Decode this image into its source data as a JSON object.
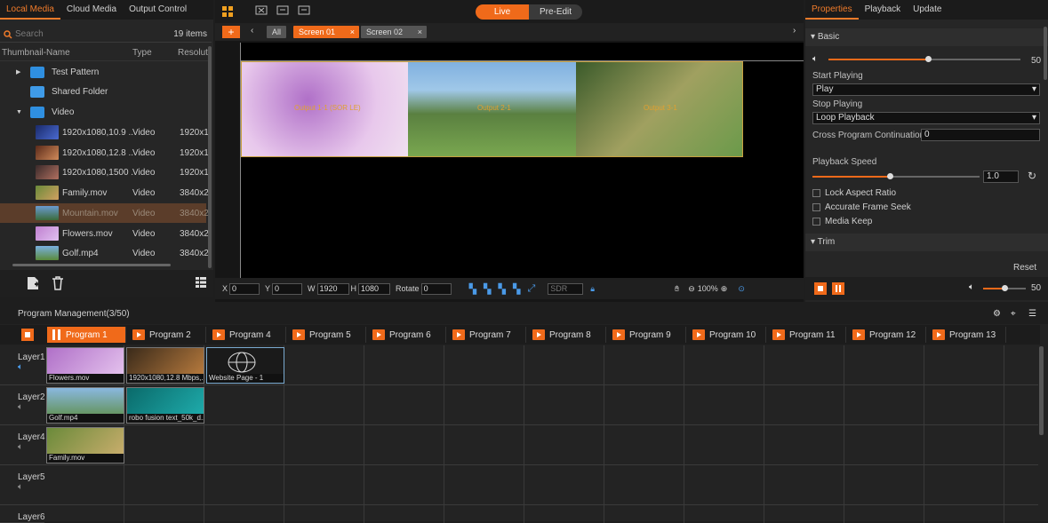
{
  "left": {
    "tabs": [
      "Local Media",
      "Cloud Media",
      "Output Control"
    ],
    "search_placeholder": "Search",
    "count": "19 items",
    "columns": [
      "Thumbnail-Name",
      "Type",
      "Resoluti"
    ],
    "folders": [
      "Test Pattern",
      "Shared Folder",
      "Video"
    ],
    "media": [
      {
        "name": "1920x1080,10.9 ...",
        "type": "Video",
        "res": "1920x1..."
      },
      {
        "name": "1920x1080,12.8 ...",
        "type": "Video",
        "res": "1920x1..."
      },
      {
        "name": "1920x1080,1500 ...",
        "type": "Video",
        "res": "1920x1..."
      },
      {
        "name": "Family.mov",
        "type": "Video",
        "res": "3840x2..."
      },
      {
        "name": "Mountain.mov",
        "type": "Video",
        "res": "3840x2..."
      },
      {
        "name": "Flowers.mov",
        "type": "Video",
        "res": "3840x2..."
      },
      {
        "name": "Golf.mp4",
        "type": "Video",
        "res": "3840x2..."
      }
    ]
  },
  "center": {
    "live": "Live",
    "preedit": "Pre-Edit",
    "screens": [
      "All",
      "Screen 01",
      "Screen 02"
    ],
    "outputs": [
      "Output 1-1 (SOR LE)",
      "Output 2-1",
      "Output 3-1"
    ],
    "x_label": "X",
    "x": "0",
    "y_label": "Y",
    "y": "0",
    "w_label": "W",
    "w": "1920",
    "h_label": "H",
    "h": "1080",
    "rotate_label": "Rotate",
    "rotate": "0",
    "sdr": "SDR",
    "zoom": "100%"
  },
  "right": {
    "tabs": [
      "Properties",
      "Playback",
      "Update"
    ],
    "basic": "Basic",
    "volume": "50",
    "start_playing_label": "Start Playing",
    "start_playing": "Play",
    "stop_playing_label": "Stop Playing",
    "stop_playing": "Loop Playback",
    "cross_label": "Cross Program Continuation",
    "cross_value": "0",
    "speed_label": "Playback Speed",
    "speed": "1.0",
    "checks": [
      "Lock Aspect Ratio",
      "Accurate Frame Seek",
      "Media Keep"
    ],
    "trim": "Trim",
    "reset": "Reset",
    "bottom_volume": "50"
  },
  "pm": {
    "title": "Program Management(3/50)",
    "programs": [
      "Program 1",
      "Program 2",
      "Program 4",
      "Program 5",
      "Program 6",
      "Program 7",
      "Program 8",
      "Program 9",
      "Program 10",
      "Program 11",
      "Program 12",
      "Program 13"
    ],
    "layers": [
      "Layer1",
      "Layer2",
      "Layer4",
      "Layer5",
      "Layer6"
    ],
    "clips": {
      "l1a": "Flowers.mov",
      "l1b": "1920x1080,12.8 Mbps,...",
      "l1c": "Website Page - 1",
      "l2a": "Golf.mp4",
      "l2b": "robo fusion text_50k_d...",
      "l4a": "Family.mov"
    }
  },
  "colors": {
    "accent": "#f06a1a",
    "bg": "#1e1e1e",
    "panel": "#262626"
  }
}
